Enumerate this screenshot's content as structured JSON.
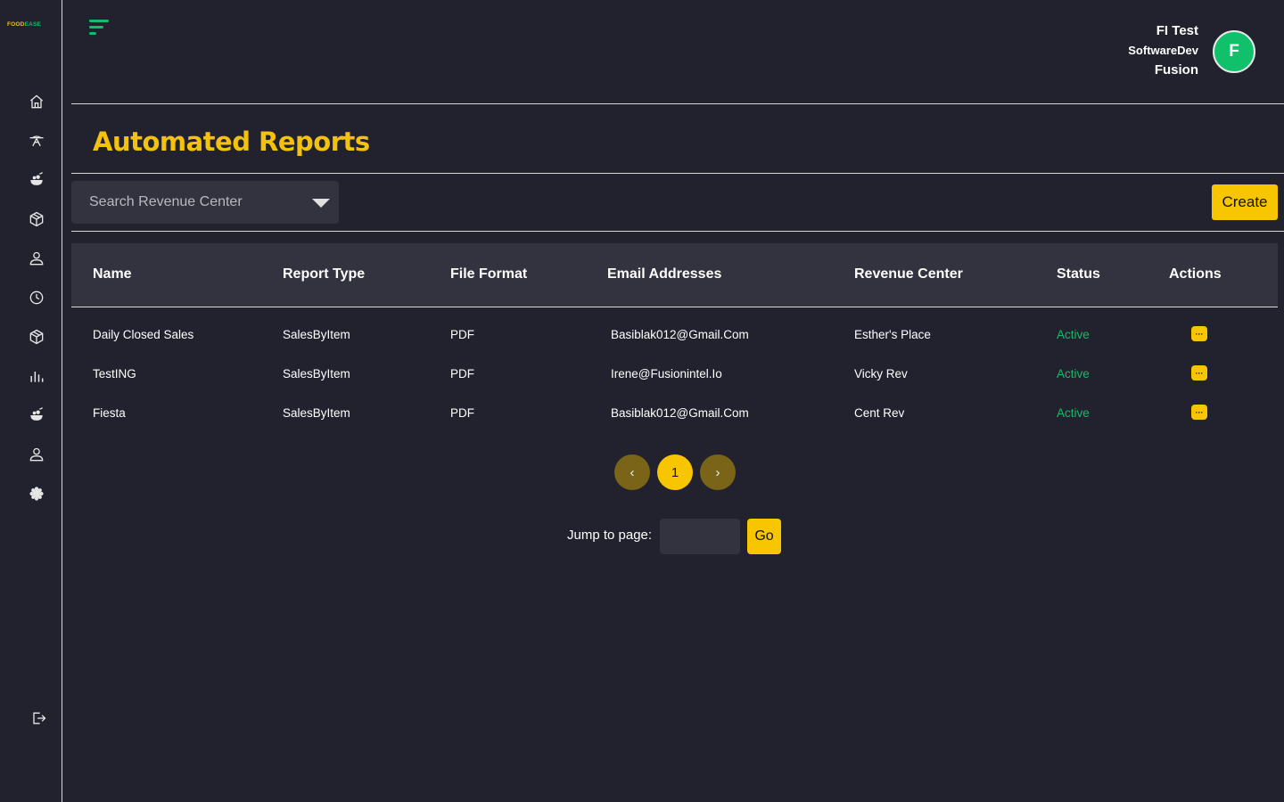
{
  "brand": {
    "logo_part1": "FOOD",
    "logo_part2": "EASE"
  },
  "sidebar": {
    "items": [
      {
        "icon": "home-icon"
      },
      {
        "icon": "food-tray-icon"
      },
      {
        "icon": "menu-bowl-icon"
      },
      {
        "icon": "box-icon"
      },
      {
        "icon": "user-icon"
      },
      {
        "icon": "clock-icon"
      },
      {
        "icon": "package-icon"
      },
      {
        "icon": "bar-chart-icon"
      },
      {
        "icon": "food-icon"
      },
      {
        "icon": "account-icon"
      },
      {
        "icon": "settings-icon"
      }
    ],
    "logout_icon": "logout-icon"
  },
  "header": {
    "user_name": "FI Test",
    "user_role": "SoftwareDev",
    "user_org": "Fusion",
    "avatar_letter": "F"
  },
  "page": {
    "title": "Automated Reports",
    "search_placeholder": "Search Revenue Center",
    "create_label": "Create"
  },
  "table": {
    "headers": {
      "name": "Name",
      "report_type": "Report Type",
      "file_format": "File Format",
      "email": "Email Addresses",
      "revenue_center": "Revenue Center",
      "status": "Status",
      "actions": "Actions"
    },
    "rows": [
      {
        "name": "Daily Closed Sales",
        "report_type": "SalesByItem",
        "file_format": "PDF",
        "email": "Basiblak012@Gmail.Com",
        "revenue_center": "Esther's Place",
        "status": "Active",
        "action": "···"
      },
      {
        "name": "TestING",
        "report_type": "SalesByItem",
        "file_format": "PDF",
        "email": "Irene@Fusionintel.Io",
        "revenue_center": "Vicky Rev",
        "status": "Active",
        "action": "···"
      },
      {
        "name": "Fiesta",
        "report_type": "SalesByItem",
        "file_format": "PDF",
        "email": "Basiblak012@Gmail.Com",
        "revenue_center": "Cent Rev",
        "status": "Active",
        "action": "···"
      }
    ]
  },
  "pagination": {
    "prev": "‹",
    "current_page": "1",
    "next": "›",
    "jump_label": "Jump to page:",
    "go_label": "Go"
  },
  "colors": {
    "accent": "#f7c600",
    "success": "#17b868",
    "background": "#22222e",
    "panel": "#33333f"
  }
}
